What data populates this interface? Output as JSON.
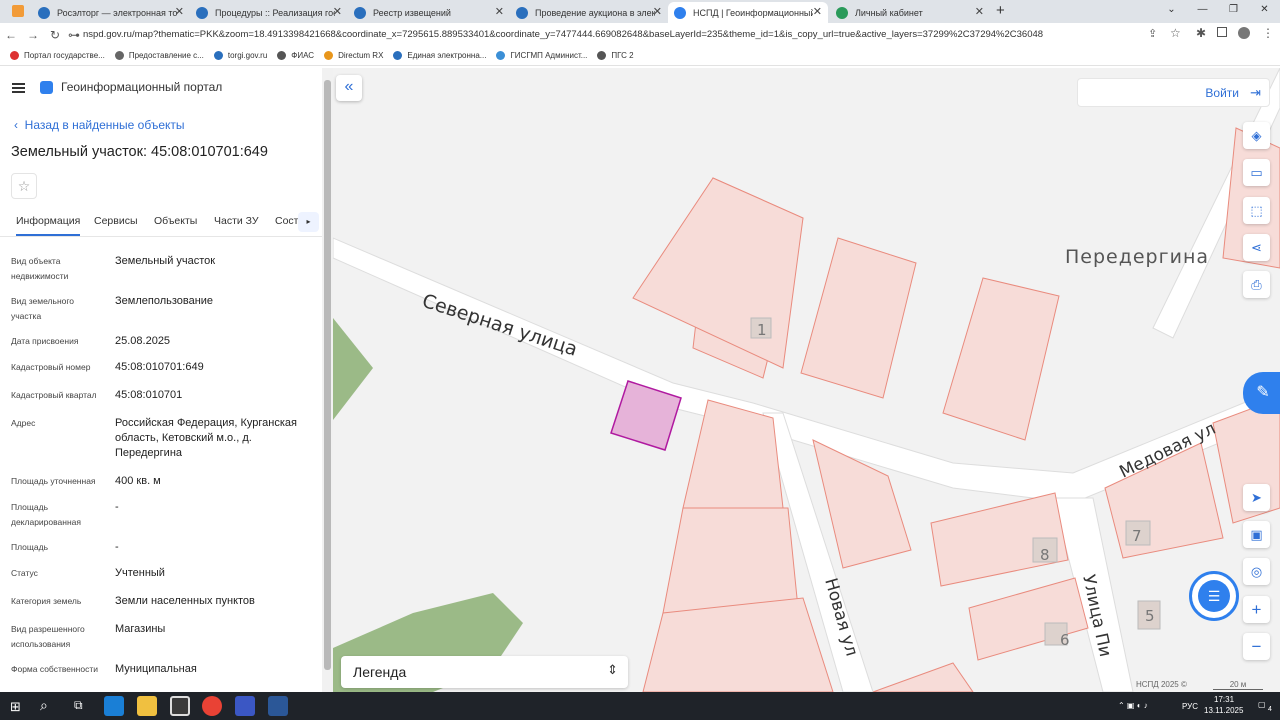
{
  "browser": {
    "tabs": [
      {
        "title": "Росэлторг — электронная торго",
        "active": false
      },
      {
        "title": "Процедуры :: Реализация госи",
        "active": false
      },
      {
        "title": "Реестр извещений",
        "active": false
      },
      {
        "title": "Проведение аукциона в электр",
        "active": false
      },
      {
        "title": "НСПД | Геоинформационный п",
        "active": true
      },
      {
        "title": "Личный кабинет",
        "active": false
      }
    ],
    "url": "nspd.gov.ru/map?thematic=PKK&zoom=18.4913398421668&coordinate_x=7295615.889533401&coordinate_y=7477444.669082648&baseLayerId=235&theme_id=1&is_copy_url=true&active_layers=37299%2C37294%2C36048",
    "bookmarks": [
      "Портал государстве...",
      "Предоставление с...",
      "torgi.gov.ru",
      "ФИАС",
      "Directum RX",
      "Единая электронна...",
      "ГИСГМП Админист...",
      "ПГС 2"
    ]
  },
  "panel": {
    "portal_title": "Геоинформационный портал",
    "back_link": "Назад в найденные объекты",
    "object_title": "Земельный участок: 45:08:010701:649",
    "tabs": [
      "Информация",
      "Сервисы",
      "Объекты",
      "Части ЗУ",
      "Соста"
    ],
    "fields": [
      {
        "label": "Вид объекта недвижимости",
        "value": "Земельный участок"
      },
      {
        "label": "Вид земельного участка",
        "value": "Землепользование"
      },
      {
        "label": "Дата присвоения",
        "value": "25.08.2025"
      },
      {
        "label": "Кадастровый номер",
        "value": "45:08:010701:649"
      },
      {
        "label": "Кадастровый квартал",
        "value": "45:08:010701"
      },
      {
        "label": "Адрес",
        "value": "Российская Федерация, Курганская область, Кетовский м.о., д. Передергина"
      },
      {
        "label": "Площадь уточненная",
        "value": "400 кв. м"
      },
      {
        "label": "Площадь декларированная",
        "value": "-"
      },
      {
        "label": "Площадь",
        "value": "-"
      },
      {
        "label": "Статус",
        "value": "Учтенный"
      },
      {
        "label": "Категория земель",
        "value": "Земли населенных пунктов"
      },
      {
        "label": "Вид разрешенного использования",
        "value": "Магазины"
      },
      {
        "label": "Форма собственности",
        "value": "Муниципальная"
      }
    ]
  },
  "map": {
    "login_label": "Войти",
    "legend_label": "Легенда",
    "labels": {
      "street_north": "Северная улица",
      "village": "Передергина",
      "street_honey": "Медовая ул",
      "street_new": "Новая ул",
      "street_pi": "Улица Пи"
    },
    "house_numbers": [
      "1",
      "8",
      "7",
      "6",
      "5"
    ],
    "copyright": "НСПД 2025 ©",
    "scale": "20 м",
    "parcel_fill": "#e6b3d9",
    "parcel_stroke": "#b01aa0",
    "building_fill": "#f7dcd8",
    "building_stroke": "#e98b7e",
    "green": "#9bba87",
    "accent": "#2f6fd6"
  },
  "taskbar": {
    "lang": "РУС",
    "time": "17:31",
    "date": "13.11.2025",
    "notif": "4"
  }
}
